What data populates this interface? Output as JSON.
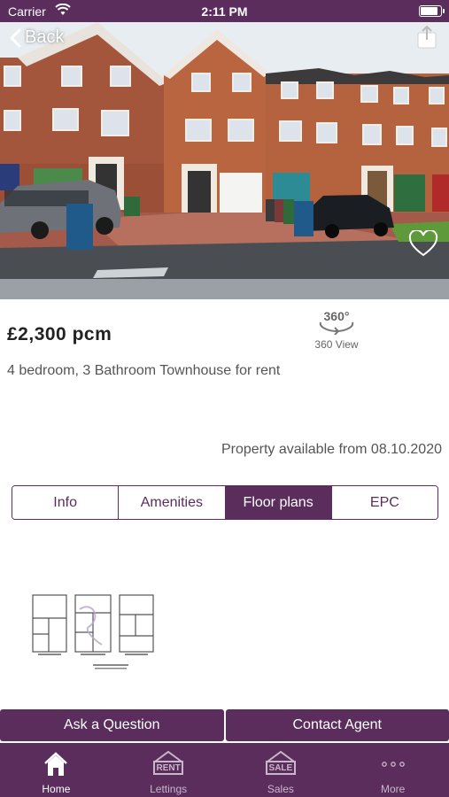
{
  "status_bar": {
    "carrier": "Carrier",
    "time": "2:11 PM",
    "battery_level": 0.9
  },
  "nav": {
    "back_label": "Back"
  },
  "listing": {
    "price": "£2,300 pcm",
    "description": "4 bedroom, 3 Bathroom Townhouse for rent",
    "view360_label": "360 View",
    "view360_badge": "360°",
    "available_text": "Property available from 08.10.2020"
  },
  "detail_tabs": [
    {
      "label": "Info",
      "active": false
    },
    {
      "label": "Amenities",
      "active": false
    },
    {
      "label": "Floor plans",
      "active": true
    },
    {
      "label": "EPC",
      "active": false
    }
  ],
  "actions": {
    "ask_question": "Ask a Question",
    "contact_agent": "Contact Agent"
  },
  "tab_bar": [
    {
      "label": "Home",
      "icon": "home-icon",
      "active": true
    },
    {
      "label": "Lettings",
      "icon": "rent-sign-icon",
      "badge": "RENT",
      "active": false
    },
    {
      "label": "Sales",
      "icon": "sale-sign-icon",
      "badge": "SALE",
      "active": false
    },
    {
      "label": "More",
      "icon": "more-dots-icon",
      "active": false
    }
  ],
  "colors": {
    "brand": "#5a2d5c",
    "text_dark": "#222222",
    "text_muted": "#555555"
  }
}
